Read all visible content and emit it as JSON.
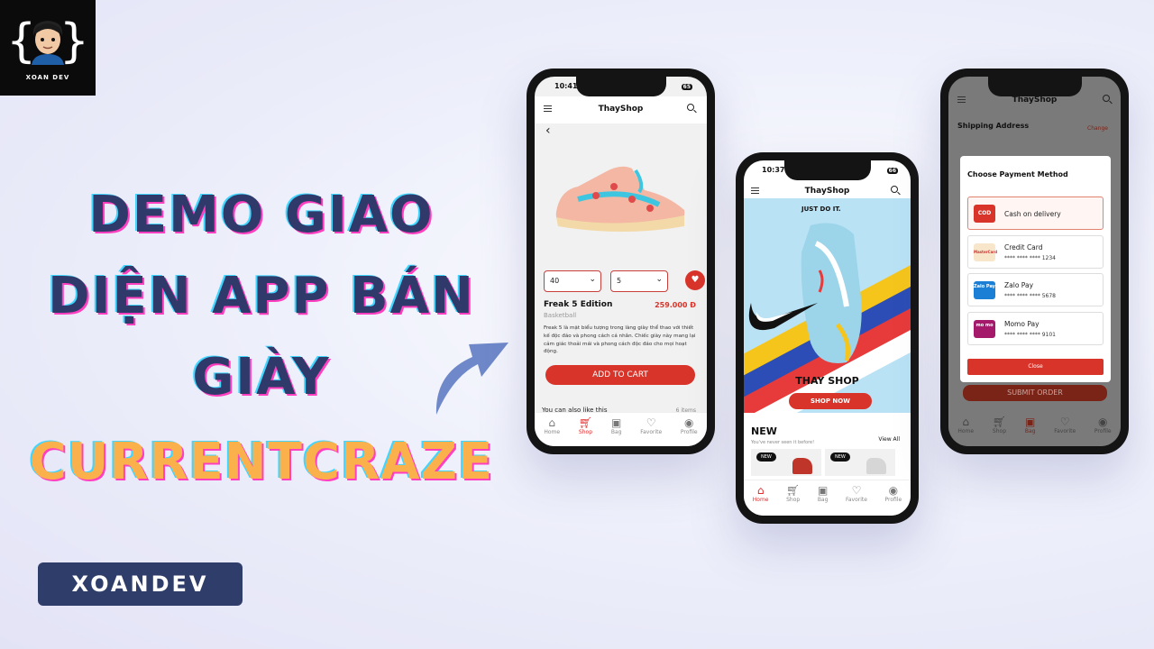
{
  "logo": {
    "caption": "XOAN DEV",
    "brace_left": "{",
    "brace_right": "}"
  },
  "headline": {
    "line1": "DEMO GIAO",
    "line2": "DIỆN APP BÁN",
    "line3": "GIÀY",
    "brand": "CURRENTCRAZE"
  },
  "badge": {
    "label": "XOANDEV"
  },
  "colors": {
    "accent": "#d9342a",
    "title": "#2f3a6b",
    "brand": "#fbb14b",
    "badge": "#2f3d6b"
  },
  "tabs": [
    {
      "label": "Home",
      "icon": "home-icon"
    },
    {
      "label": "Shop",
      "icon": "cart-icon"
    },
    {
      "label": "Bag",
      "icon": "bag-icon"
    },
    {
      "label": "Favorite",
      "icon": "heart-icon"
    },
    {
      "label": "Profile",
      "icon": "profile-icon"
    }
  ],
  "phone1": {
    "time": "10:41",
    "battery": "65",
    "title": "ThayShop",
    "size_value": "40",
    "qty_value": "5",
    "product_name": "Freak 5 Edition",
    "price": "259.000 Đ",
    "category": "Basketball",
    "description": "Freak 5 là mặt biểu tượng trong làng giày thể thao với thiết kế độc đáo và phong cách cá nhân. Chiếc giày này mang lại cảm giác thoải mái và phong cách độc đáo cho mọi hoạt động.",
    "add_to_cart": "ADD TO CART",
    "also_like": "You can also like this",
    "items_count": "6 items"
  },
  "phone2": {
    "time": "10:37",
    "battery": "66",
    "title": "ThayShop",
    "just_do_it": "JUST DO IT.",
    "hero_title": "THAY SHOP",
    "shop_now": "SHOP NOW",
    "new_title": "NEW",
    "new_subtitle": "You've never seen it before!",
    "view_all": "View All",
    "tag_new": "NEW"
  },
  "phone3": {
    "title": "ThayShop",
    "shipping": "Shipping Address",
    "change": "Change",
    "modal_title": "Choose Payment Method",
    "methods": [
      {
        "name": "Cash on delivery",
        "number": "",
        "logo": "COD"
      },
      {
        "name": "Credit Card",
        "number": "**** **** **** 1234",
        "logo": "MasterCard"
      },
      {
        "name": "Zalo Pay",
        "number": "**** **** **** 5678",
        "logo": "Zalo Pay"
      },
      {
        "name": "Momo Pay",
        "number": "**** **** **** 9101",
        "logo": "mo mo"
      }
    ],
    "close": "Close",
    "submit": "SUBMIT ORDER"
  }
}
